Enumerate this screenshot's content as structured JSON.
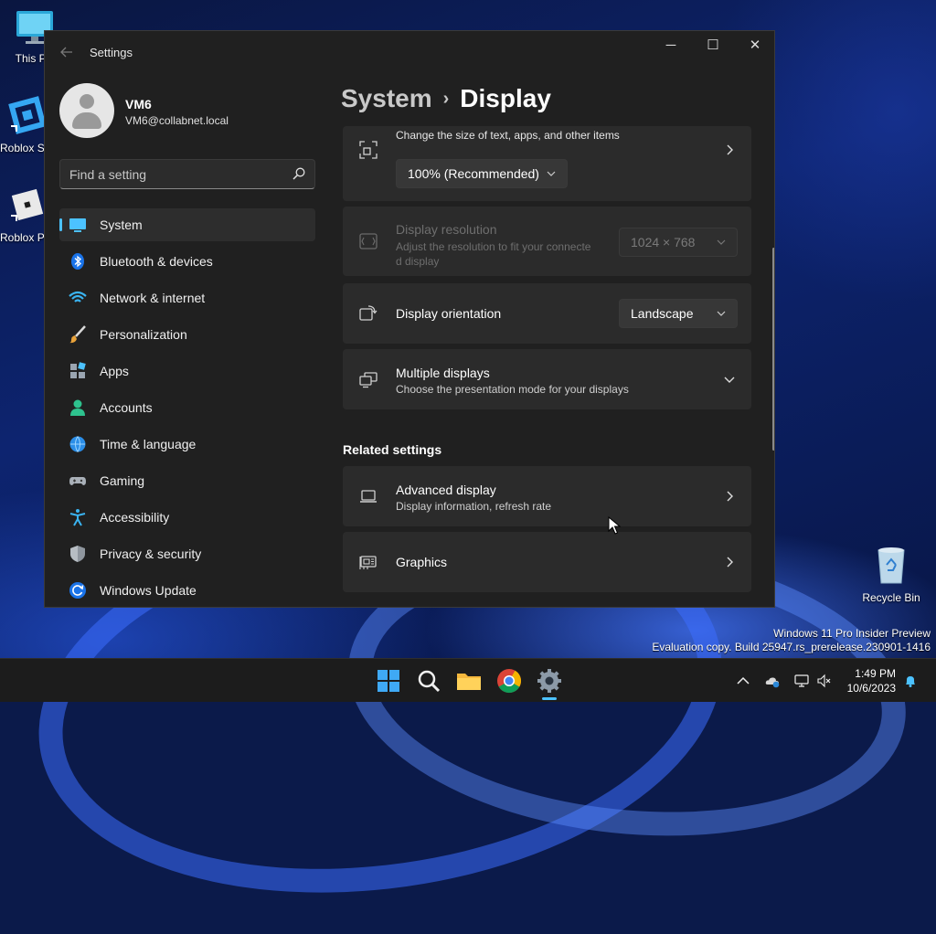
{
  "desktop": {
    "icons": [
      {
        "label": "This PC"
      },
      {
        "label": "Roblox Studio"
      },
      {
        "label": "Roblox Player"
      },
      {
        "label": "Recycle Bin"
      }
    ],
    "watermark": {
      "line1": "Windows 11 Pro Insider Preview",
      "line2": "Evaluation copy. Build 25947.rs_prerelease.230901-1416"
    }
  },
  "window": {
    "title": "Settings",
    "back_icon": "arrow-left-icon",
    "minimize_glyph": "─",
    "maximize_glyph": "☐",
    "close_glyph": "✕"
  },
  "profile": {
    "name": "VM6",
    "email": "VM6@collabnet.local"
  },
  "search": {
    "placeholder": "Find a setting"
  },
  "sidebar": {
    "items": [
      {
        "label": "System",
        "icon": "system-icon",
        "active": true
      },
      {
        "label": "Bluetooth & devices",
        "icon": "bluetooth-icon"
      },
      {
        "label": "Network & internet",
        "icon": "wifi-icon"
      },
      {
        "label": "Personalization",
        "icon": "brush-icon"
      },
      {
        "label": "Apps",
        "icon": "apps-icon"
      },
      {
        "label": "Accounts",
        "icon": "person-icon"
      },
      {
        "label": "Time & language",
        "icon": "globe-clock-icon"
      },
      {
        "label": "Gaming",
        "icon": "gamepad-icon"
      },
      {
        "label": "Accessibility",
        "icon": "accessibility-icon"
      },
      {
        "label": "Privacy & security",
        "icon": "shield-icon"
      },
      {
        "label": "Windows Update",
        "icon": "refresh-icon"
      }
    ]
  },
  "breadcrumb": {
    "parent": "System",
    "separator": "›",
    "current": "Display"
  },
  "settings": {
    "scale": {
      "desc": "Change the size of text, apps, and other items",
      "value": "100% (Recommended)"
    },
    "resolution": {
      "title": "Display resolution",
      "desc_line1": "Adjust the resolution to fit your connecte",
      "desc_line2": "d display",
      "value": "1024 × 768",
      "enabled": false
    },
    "orientation": {
      "title": "Display orientation",
      "value": "Landscape"
    },
    "multiple": {
      "title": "Multiple displays",
      "desc": "Choose the presentation mode for your displays"
    },
    "related_heading": "Related settings",
    "advanced": {
      "title": "Advanced display",
      "desc": "Display information, refresh rate"
    },
    "graphics": {
      "title": "Graphics"
    }
  },
  "taskbar": {
    "apps": [
      {
        "name": "start-icon"
      },
      {
        "name": "search-icon"
      },
      {
        "name": "file-explorer-icon"
      },
      {
        "name": "chrome-icon"
      },
      {
        "name": "settings-icon",
        "active": true
      }
    ],
    "time": "1:49 PM",
    "date": "10/6/2023"
  },
  "colors": {
    "accent": "#4cc2ff",
    "window_bg": "#202020",
    "card_bg": "#2b2b2b"
  }
}
